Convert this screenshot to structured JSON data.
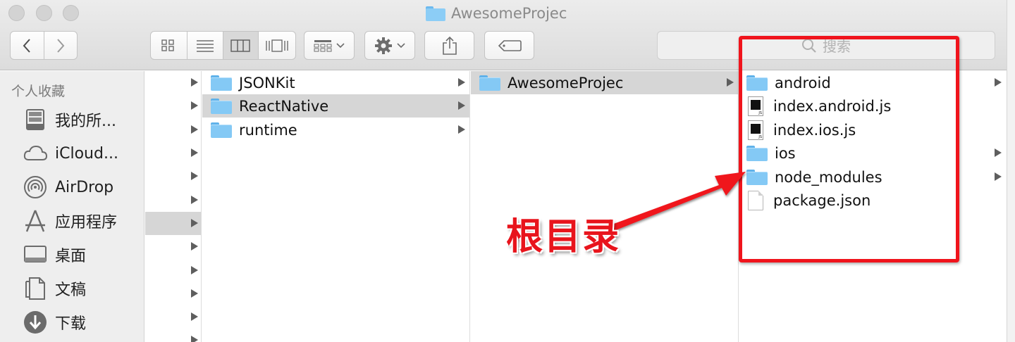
{
  "window": {
    "title": "AwesomeProjec"
  },
  "search": {
    "placeholder": "搜索"
  },
  "sidebar": {
    "header": "个人收藏",
    "items": [
      {
        "label": "我的所...",
        "icon": "all-files-icon"
      },
      {
        "label": "iCloud...",
        "icon": "cloud-icon"
      },
      {
        "label": "AirDrop",
        "icon": "airdrop-icon"
      },
      {
        "label": "应用程序",
        "icon": "applications-icon"
      },
      {
        "label": "桌面",
        "icon": "desktop-icon"
      },
      {
        "label": "文稿",
        "icon": "documents-icon"
      },
      {
        "label": "下载",
        "icon": "downloads-icon"
      }
    ]
  },
  "columns": {
    "col2": [
      {
        "name": "JSONKit",
        "type": "folder"
      },
      {
        "name": "ReactNative",
        "type": "folder",
        "selected": true
      },
      {
        "name": "runtime",
        "type": "folder"
      }
    ],
    "col3": [
      {
        "name": "AwesomeProjec",
        "type": "folder",
        "selected": true
      }
    ],
    "col4": [
      {
        "name": "android",
        "type": "folder"
      },
      {
        "name": "index.android.js",
        "type": "js-file"
      },
      {
        "name": "index.ios.js",
        "type": "js-file"
      },
      {
        "name": "ios",
        "type": "folder"
      },
      {
        "name": "node_modules",
        "type": "folder"
      },
      {
        "name": "package.json",
        "type": "document"
      }
    ]
  },
  "annotation": {
    "label": "根目录",
    "color": "#e8141c"
  },
  "colors": {
    "selection": "#d6d6d6",
    "folder": "#84c9f5",
    "annotation_red": "#f0141c"
  }
}
